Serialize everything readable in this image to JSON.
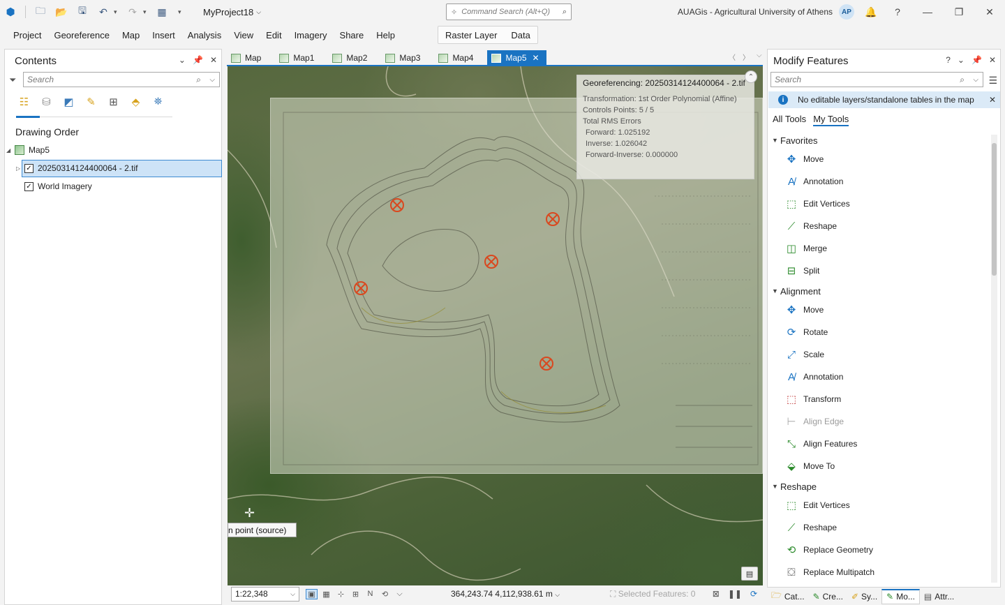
{
  "titlebar": {
    "project": "MyProject18",
    "command_search_placeholder": "Command Search (Alt+Q)",
    "org": "AUAGis - Agricultural University of Athens",
    "avatar": "AP",
    "help": "?"
  },
  "ribbon": {
    "tabs": [
      "Project",
      "Georeference",
      "Map",
      "Insert",
      "Analysis",
      "View",
      "Edit",
      "Imagery",
      "Share",
      "Help"
    ],
    "context_tabs": [
      "Raster Layer",
      "Data"
    ]
  },
  "contents": {
    "title": "Contents",
    "search_placeholder": "Search",
    "drawing_order": "Drawing Order",
    "map_name": "Map5",
    "layers": [
      {
        "name": "20250314124400064 - 2.tif",
        "checked": true,
        "selected": true
      },
      {
        "name": "World Imagery",
        "checked": true,
        "selected": false
      }
    ]
  },
  "map_tabs": [
    {
      "label": "Map",
      "active": false
    },
    {
      "label": "Map1",
      "active": false
    },
    {
      "label": "Map2",
      "active": false
    },
    {
      "label": "Map3",
      "active": false
    },
    {
      "label": "Map4",
      "active": false
    },
    {
      "label": "Map5",
      "active": true
    }
  ],
  "georef": {
    "title": "Georeferencing: 20250314124400064 - 2.tif",
    "transformation": "Transformation: 1st Order Polynomial (Affine)",
    "controls": "Controls Points: 5 / 5",
    "rms": "Total RMS Errors",
    "forward": "Forward: 1.025192",
    "inverse": "Inverse: 1.026042",
    "forward_inverse": "Forward-Inverse: 0.000000"
  },
  "map": {
    "tooltip": "n point (source)",
    "control_points": 5
  },
  "status": {
    "scale": "1:22,348",
    "coords": "364,243.74 4,112,938.61 m",
    "selected": "Selected Features: 0"
  },
  "modify": {
    "title": "Modify Features",
    "help": "?",
    "search_placeholder": "Search",
    "info": "No editable layers/standalone tables in the map",
    "tabs": [
      "All Tools",
      "My Tools"
    ],
    "groups": [
      {
        "name": "Favorites",
        "tools": [
          "Move",
          "Annotation",
          "Edit Vertices",
          "Reshape",
          "Merge",
          "Split"
        ]
      },
      {
        "name": "Alignment",
        "tools": [
          "Move",
          "Rotate",
          "Scale",
          "Annotation",
          "Transform",
          "Align Edge",
          "Align Features",
          "Move To"
        ]
      },
      {
        "name": "Reshape",
        "tools": [
          "Edit Vertices",
          "Reshape",
          "Replace Geometry",
          "Replace Multipatch"
        ]
      }
    ]
  },
  "dock_tabs": [
    "Cat...",
    "Cre...",
    "Sy...",
    "Mo...",
    "Attr..."
  ],
  "colors": {
    "accent": "#1a73c2",
    "control_point": "#d9481f"
  }
}
